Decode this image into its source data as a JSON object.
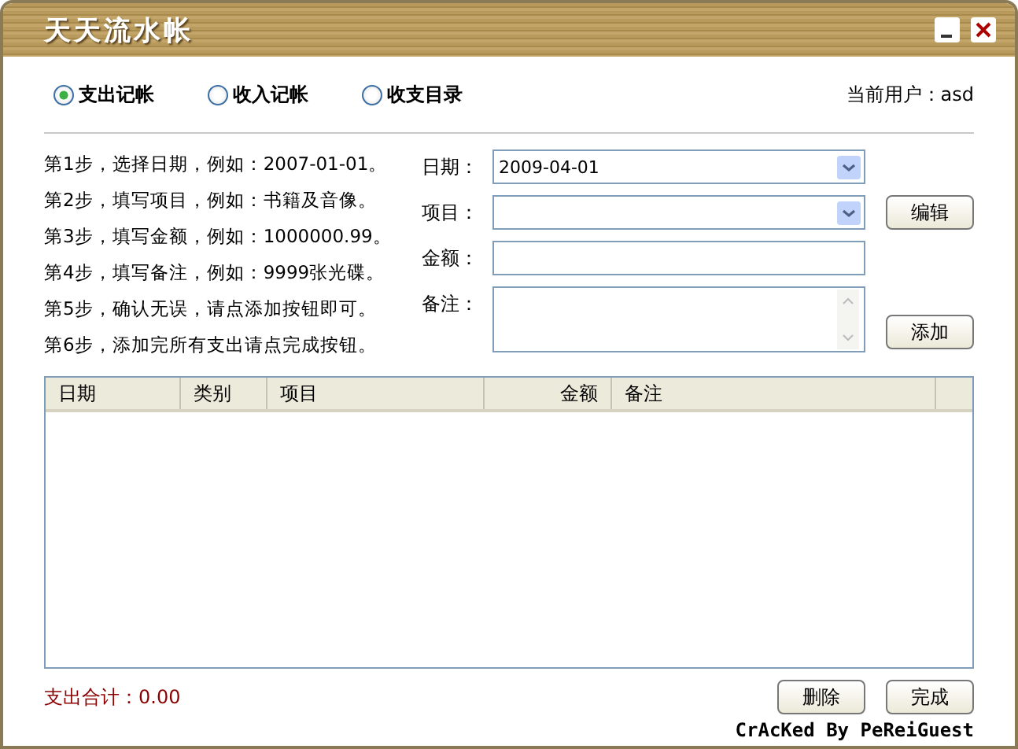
{
  "window": {
    "title": "天天流水帐"
  },
  "modes": [
    {
      "label": "支出记帐",
      "selected": true
    },
    {
      "label": "收入记帐",
      "selected": false
    },
    {
      "label": "收支目录",
      "selected": false
    }
  ],
  "current_user": "当前用户：asd",
  "steps": [
    "第1步，选择日期，例如：2007-01-01。",
    "第2步，填写项目，例如：书籍及音像。",
    "第3步，填写金额，例如：1000000.99。",
    "第4步，填写备注，例如：9999张光碟。",
    "第5步，确认无误，请点添加按钮即可。",
    "第6步，添加完所有支出请点完成按钮。"
  ],
  "form": [
    {
      "kind": "dropdown",
      "label": "日期：",
      "value": "2009-04-01"
    },
    {
      "kind": "dropdown",
      "label": "项目：",
      "button": "编辑"
    },
    {
      "kind": "text",
      "label": "金额："
    },
    {
      "kind": "memo",
      "label": "备注：",
      "button": "添加"
    }
  ],
  "table": {
    "columns": [
      "日期",
      "类别",
      "项目",
      "金额",
      "备注"
    ]
  },
  "total": "支出合计：0.00",
  "buttons": [
    "删除",
    "完成"
  ],
  "credit": "CrAcKed By PeReiGuest"
}
